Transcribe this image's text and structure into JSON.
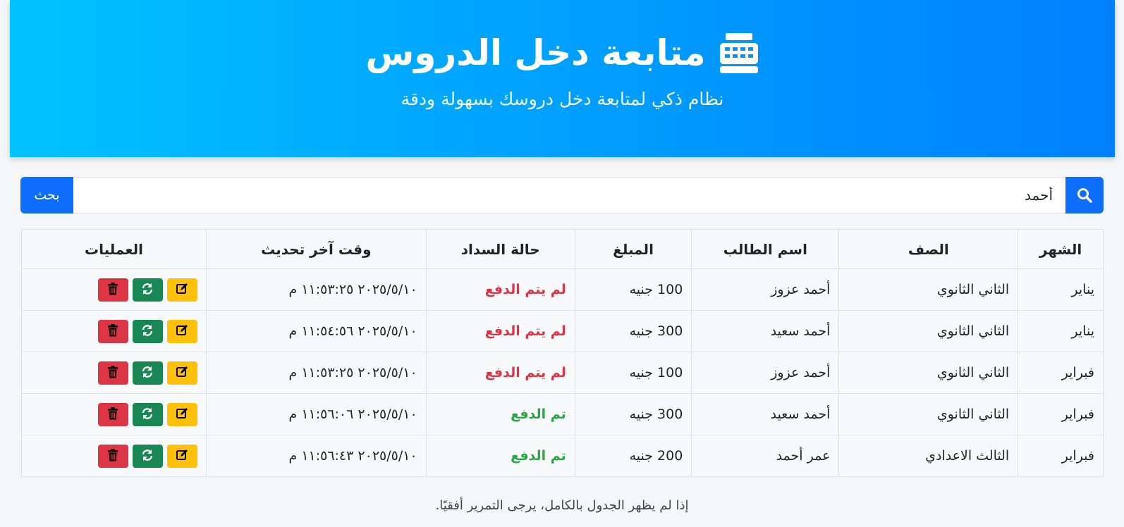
{
  "header": {
    "title": "متابعة دخل الدروس",
    "subtitle": "نظام ذكي لمتابعة دخل دروسك بسهولة ودقة",
    "icon": "cash-register-icon"
  },
  "search": {
    "value": "أحمد",
    "button_label": "بحث",
    "icon": "search-icon"
  },
  "table": {
    "headers": [
      "الشهر",
      "الصف",
      "اسم الطالب",
      "المبلغ",
      "حالة السداد",
      "وقت آخر تحديث",
      "العمليات"
    ],
    "rows": [
      {
        "month": "يناير",
        "grade": "الثاني الثانوي",
        "student": "أحمد عزوز",
        "amount": "100 جنيه",
        "status": "لم يتم الدفع",
        "paid": false,
        "updated": "٢٠٢٥/٥/١٠ ١١:٥٣:٢٥ م"
      },
      {
        "month": "يناير",
        "grade": "الثاني الثانوي",
        "student": "أحمد سعيد",
        "amount": "300 جنيه",
        "status": "لم يتم الدفع",
        "paid": false,
        "updated": "٢٠٢٥/٥/١٠ ١١:٥٤:٥٦ م"
      },
      {
        "month": "فبراير",
        "grade": "الثاني الثانوي",
        "student": "أحمد عزوز",
        "amount": "100 جنيه",
        "status": "لم يتم الدفع",
        "paid": false,
        "updated": "٢٠٢٥/٥/١٠ ١١:٥٣:٢٥ م"
      },
      {
        "month": "فبراير",
        "grade": "الثاني الثانوي",
        "student": "أحمد سعيد",
        "amount": "300 جنيه",
        "status": "تم الدفع",
        "paid": true,
        "updated": "٢٠٢٥/٥/١٠ ١١:٥٦:٠٦ م"
      },
      {
        "month": "فبراير",
        "grade": "الثالث الاعدادي",
        "student": "عمر أحمد",
        "amount": "200 جنيه",
        "status": "تم الدفع",
        "paid": true,
        "updated": "٢٠٢٥/٥/١٠ ١١:٥٦:٤٣ م"
      }
    ],
    "operations": [
      "edit-icon",
      "refresh-icon",
      "trash-icon"
    ]
  },
  "footer": {
    "note": "إذا لم يظهر الجدول بالكامل، يرجى التمرير أفقيًا."
  },
  "colors": {
    "primary": "#0d6efd",
    "unpaid": "#dc3545",
    "paid": "#28a745",
    "edit": "#ffc107",
    "refresh": "#198754",
    "delete": "#dc3545"
  }
}
